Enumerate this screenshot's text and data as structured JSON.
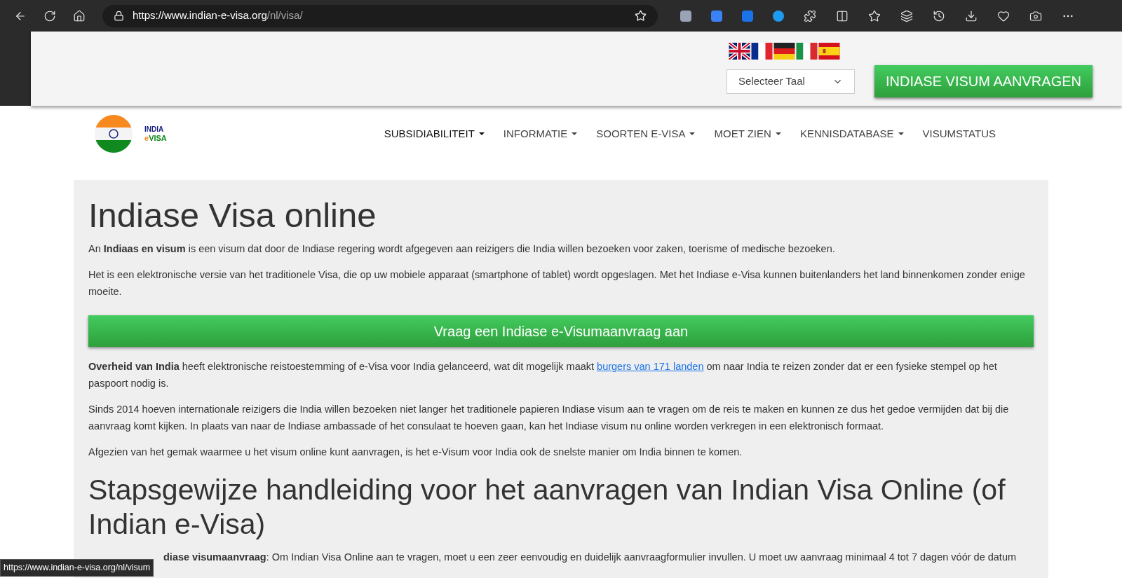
{
  "browser": {
    "url_host": "https://www.indian-e-visa.org",
    "url_path": "/nl/visa/",
    "status_url": "https://www.indian-e-visa.org/nl/visum"
  },
  "header": {
    "language_select": "Selecteer Taal",
    "apply_button": "INDIASE VISUM AANVRAGEN"
  },
  "logo": {
    "line1": "INDIA",
    "line2_prefix": "e",
    "line2_rest": "VISA"
  },
  "nav": [
    {
      "label": "SUBSIDIABILITEIT",
      "dropdown": true,
      "selected": true
    },
    {
      "label": "INFORMATIE",
      "dropdown": true,
      "selected": false
    },
    {
      "label": "SOORTEN E-VISA",
      "dropdown": true,
      "selected": false
    },
    {
      "label": "MOET ZIEN",
      "dropdown": true,
      "selected": false
    },
    {
      "label": "KENNISDATABASE",
      "dropdown": true,
      "selected": false
    },
    {
      "label": "VISUMSTATUS",
      "dropdown": false,
      "selected": false
    }
  ],
  "main": {
    "title": "Indiase Visa online",
    "intro": [
      "An **Indiaas en visum** is een visum dat door de Indiase regering wordt afgegeven aan reizigers die India willen bezoeken voor zaken, toerisme of medische bezoeken.",
      "Het is een elektronische versie van het traditionele Visa, die op uw mobiele apparaat (smartphone of tablet) wordt opgeslagen. Met het Indiase e-Visa kunnen buitenlanders het land binnenkomen zonder enige moeite."
    ],
    "cta": "Vraag een Indiase e-Visumaanvraag aan",
    "para_lead": "Overheid van India",
    "para_before_link": " heeft elektronische reistoestemming of e-Visa voor India gelanceerd, wat dit mogelijk maakt ",
    "para_link": "burgers van 171 landen",
    "para_after_link": " om naar India te reizen zonder dat er een fysieke stempel op het paspoort nodig is.",
    "paragraphs": [
      "Sinds 2014 hoeven internationale reizigers die India willen bezoeken niet langer het traditionele papieren Indiase visum aan te vragen om de reis te maken en kunnen ze dus het gedoe vermijden dat bij die aanvraag komt kijken. In plaats van naar de Indiase ambassade of het consulaat te hoeven gaan, kan het Indiase visum nu online worden verkregen in een elektronisch formaat.",
      "Afgezien van het gemak waarmee u het visum online kunt aanvragen, is het e-Visum voor India ook de snelste manier om India binnen te komen."
    ],
    "heading": "Stapsgewijze handleiding voor het aanvragen van Indian Visa Online (of Indian e-Visa)",
    "cut_paragraph": "**diase visumaanvraag**: Om Indian Visa Online aan te vragen, moet u een zeer eenvoudig en duidelijk aanvraagformulier invullen. U moet uw aanvraag minimaal 4 tot 7 dagen vóór de datum"
  }
}
